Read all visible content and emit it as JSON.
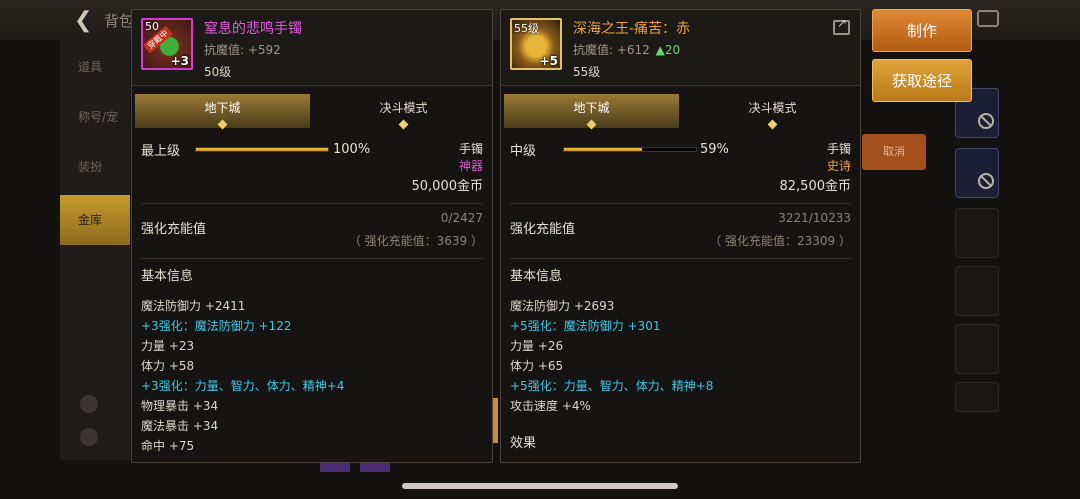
{
  "colors": {
    "legendary_purple": "#e05ad8",
    "epic_orange": "#f0a23c",
    "enhance_cyan": "#3cc8e6",
    "bonus_green": "#6fd36a",
    "button_orange": "#d17a2a"
  },
  "left_item": {
    "icon": "legendary-bracelet-icon",
    "icon_level": "50",
    "icon_badge": "穿戴中",
    "icon_plus": "+3",
    "name": "窒息的悲鸣手镯",
    "stat": "抗魔值: +592",
    "level": "50级",
    "tabs": [
      "地下城",
      "决斗模式"
    ],
    "grade_label": "最上级",
    "grade_percent": 100,
    "grade_percent_text": "100%",
    "slot": "手镯",
    "rarity": "神器",
    "price": "50,000金币",
    "enhance_label": "强化充能值",
    "enhance_value": "0/2427",
    "enhance_sub": "（ 强化充能值：3639 ）",
    "basic_info_title": "基本信息",
    "attributes": [
      {
        "text": "魔法防御力 +2411",
        "style": "white"
      },
      {
        "text": "+3强化：魔法防御力 +122",
        "style": "cyan"
      },
      {
        "text": "力量 +23",
        "style": "white"
      },
      {
        "text": "体力 +58",
        "style": "white"
      },
      {
        "text": "+3强化：力量、智力、体力、精神+4",
        "style": "cyan"
      },
      {
        "text": "物理暴击 +34",
        "style": "white"
      },
      {
        "text": "魔法暴击 +34",
        "style": "white"
      },
      {
        "text": "命中 +75",
        "style": "white"
      }
    ]
  },
  "right_item": {
    "icon": "epic-bracelet-icon",
    "icon_level": "55级",
    "icon_plus": "+5",
    "name": "深海之王-痛苦：赤",
    "stat": "抗魔值: +612",
    "stat_bonus": "▲20",
    "level": "55级",
    "tabs": [
      "地下城",
      "决斗模式"
    ],
    "grade_label": "中级",
    "grade_percent": 59,
    "grade_percent_text": "59%",
    "slot": "手镯",
    "rarity": "史诗",
    "price": "82,500金币",
    "enhance_label": "强化充能值",
    "enhance_value": "3221/10233",
    "enhance_sub": "（ 强化充能值：23309 ）",
    "basic_info_title": "基本信息",
    "attributes": [
      {
        "text": "魔法防御力 +2693",
        "style": "white"
      },
      {
        "text": "+5强化：魔法防御力 +301",
        "style": "cyan"
      },
      {
        "text": "力量 +26",
        "style": "white"
      },
      {
        "text": "体力 +65",
        "style": "white"
      },
      {
        "text": "+5强化：力量、智力、体力、精神+8",
        "style": "cyan"
      },
      {
        "text": "攻击速度 +4%",
        "style": "white"
      }
    ],
    "effects_title": "效果"
  },
  "actions": {
    "craft": "制作",
    "source": "获取途径"
  },
  "background": {
    "title": "背包",
    "side_items": [
      "道具",
      "称号/宠",
      "装扮",
      "金库"
    ],
    "cancel": "取消"
  }
}
